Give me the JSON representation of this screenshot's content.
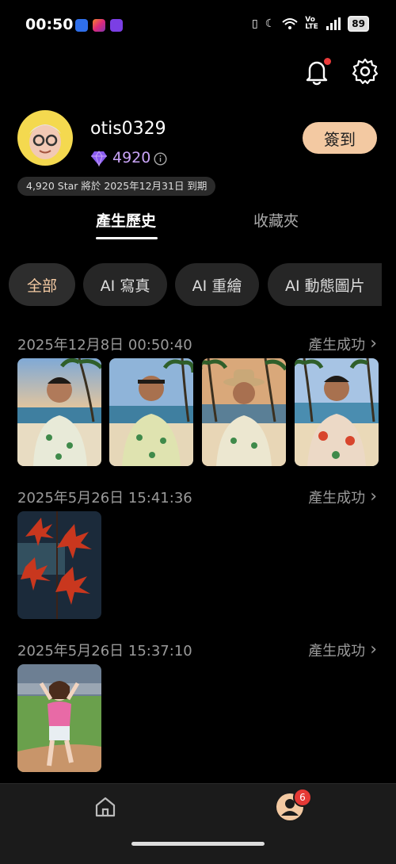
{
  "status_bar": {
    "time": "00:50",
    "network": "Vo LTE",
    "battery": "89"
  },
  "profile": {
    "username": "otis0329",
    "points": "4920",
    "expire_note": "4,920 Star 將於  2025年12月31日 到期",
    "checkin_label": "簽到"
  },
  "tabs": [
    {
      "label": "產生歷史"
    },
    {
      "label": "收藏夾"
    }
  ],
  "filters": [
    {
      "label": "全部"
    },
    {
      "label": "AI 寫真"
    },
    {
      "label": "AI 重繪"
    },
    {
      "label": "AI 動態圖片"
    }
  ],
  "history": [
    {
      "date": "2025年12月8日 00:50:40",
      "status": "產生成功"
    },
    {
      "date": "2025年5月26日 15:41:36",
      "status": "產生成功"
    },
    {
      "date": "2025年5月26日 15:37:10",
      "status": "產生成功"
    }
  ],
  "bottom_nav": {
    "profile_badge": "6"
  },
  "colors": {
    "accent": "#f3c9a2",
    "points": "#c9a4f7",
    "badge": "#e53935"
  }
}
